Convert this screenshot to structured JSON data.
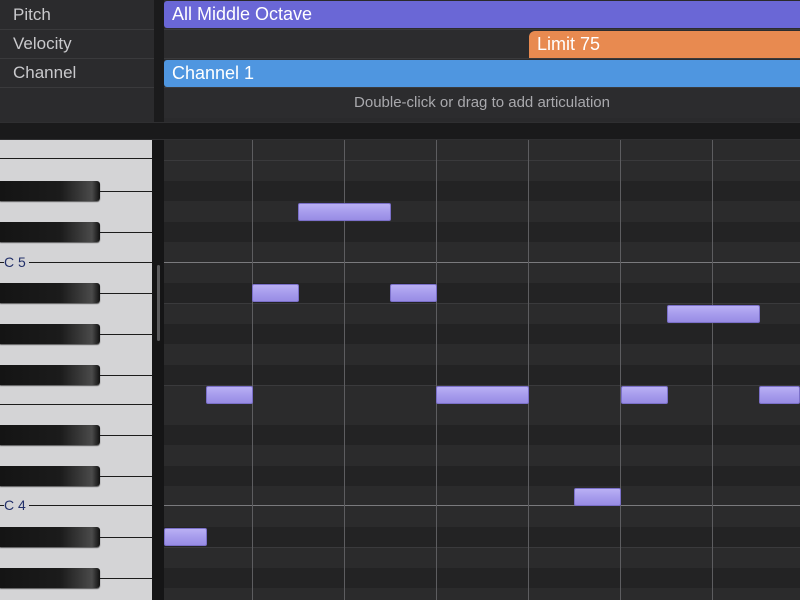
{
  "lanes": {
    "labels": [
      "Pitch",
      "Velocity",
      "Channel"
    ],
    "pitch_region": "All Middle Octave",
    "velocity_region": "Limit 75",
    "channel_region": "Channel 1",
    "hint": "Double-click or drag to add articulation"
  },
  "keyboard": {
    "octave_labels": [
      "C 5",
      "C 4"
    ]
  },
  "colors": {
    "pitch": "#6a67d6",
    "velocity": "#e88a50",
    "channel": "#4f96e0",
    "note": "#a79ced"
  }
}
